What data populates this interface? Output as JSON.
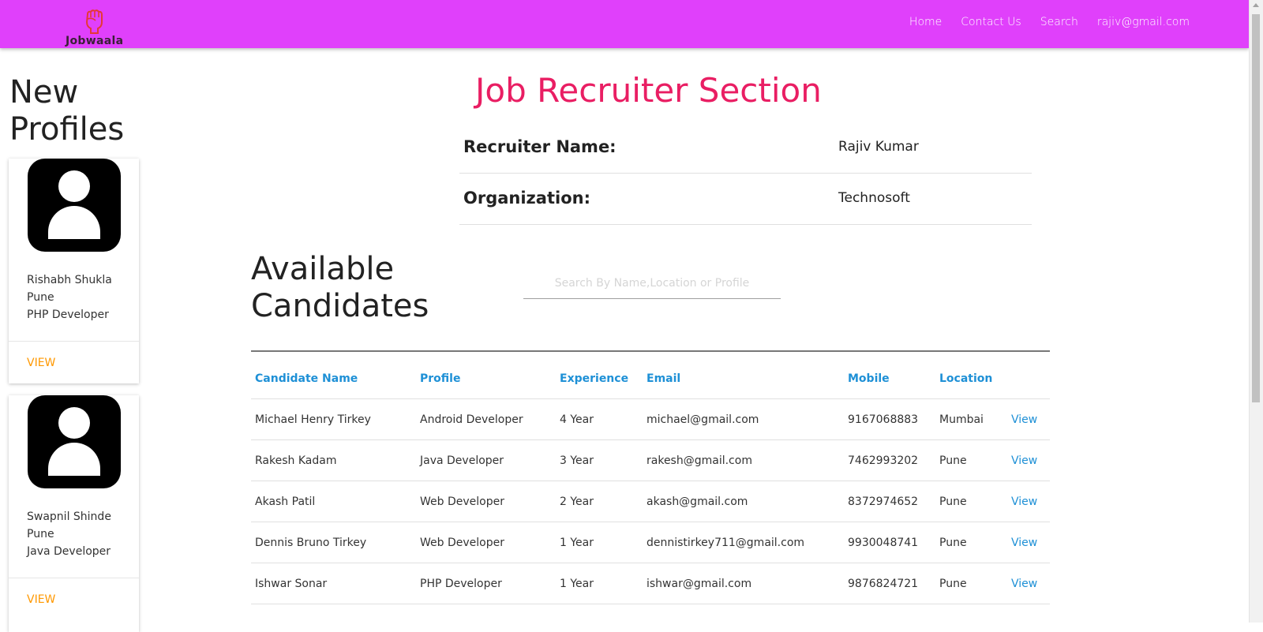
{
  "navbar": {
    "brand": "Jobwaala",
    "links": [
      "Home",
      "Contact Us",
      "Search",
      "rajiv@gmail.com"
    ]
  },
  "sidebar": {
    "title": "New Profiles",
    "cards": [
      {
        "name": "Rishabh Shukla",
        "location": "Pune",
        "profile": "PHP Developer",
        "action": "VIEW"
      },
      {
        "name": "Swapnil Shinde",
        "location": "Pune",
        "profile": "Java Developer",
        "action": "VIEW"
      }
    ]
  },
  "main": {
    "title": "Job Recruiter Section",
    "recruiter": {
      "name_label": "Recruiter Name:",
      "name_value": "Rajiv Kumar",
      "org_label": "Organization:",
      "org_value": "Technosoft"
    },
    "candidates_title": "Available Candidates",
    "search_placeholder": "Search By Name,Location or Profile",
    "columns": [
      "Candidate Name",
      "Profile",
      "Experience",
      "Email",
      "Mobile",
      "Location",
      ""
    ],
    "rows": [
      [
        "Michael Henry Tirkey",
        "Android Developer",
        "4 Year",
        "michael@gmail.com",
        "9167068883",
        "Mumbai",
        "View"
      ],
      [
        "Rakesh Kadam",
        "Java Developer",
        "3 Year",
        "rakesh@gmail.com",
        "7462993202",
        "Pune",
        "View"
      ],
      [
        "Akash Patil",
        "Web Developer",
        "2 Year",
        "akash@gmail.com",
        "8372974652",
        "Pune",
        "View"
      ],
      [
        "Dennis Bruno Tirkey",
        "Web Developer",
        "1 Year",
        "dennistirkey711@gmail.com",
        "9930048741",
        "Pune",
        "View"
      ],
      [
        "Ishwar Sonar",
        "PHP Developer",
        "1 Year",
        "ishwar@gmail.com",
        "9876824721",
        "Pune",
        "View"
      ]
    ]
  },
  "colors": {
    "navbar": "#e040fb",
    "title": "#e91e63",
    "link": "#1e90d6",
    "card_action": "#ff9800"
  }
}
